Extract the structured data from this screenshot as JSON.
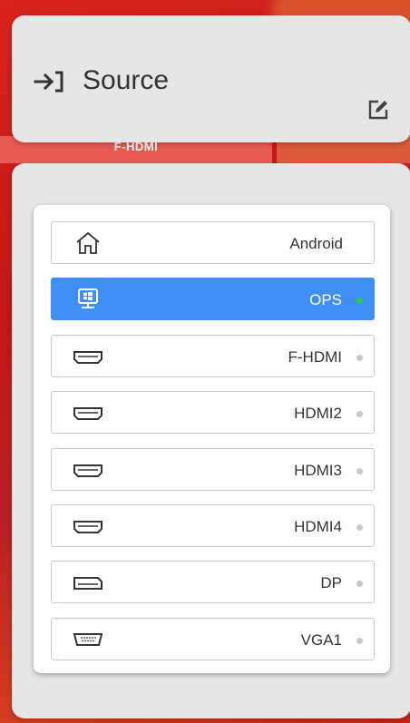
{
  "background": {
    "tile_label": "F-HDMI"
  },
  "header": {
    "icon": "input-arrow-icon",
    "title": "Source",
    "edit_icon": "edit-icon"
  },
  "colors": {
    "active_bg": "#3f8ef5",
    "signal_dot": "#2ecc40",
    "idle_dot": "#c8c8c8",
    "card_bg": "#e6e6e6"
  },
  "sources": [
    {
      "label": "Android",
      "icon": "home-icon",
      "active": false,
      "status": "none"
    },
    {
      "label": "OPS",
      "icon": "windows-pc-icon",
      "active": true,
      "status": "signal"
    },
    {
      "label": "F-HDMI",
      "icon": "hdmi-port-icon",
      "active": false,
      "status": "idle"
    },
    {
      "label": "HDMI2",
      "icon": "hdmi-port-icon",
      "active": false,
      "status": "idle"
    },
    {
      "label": "HDMI3",
      "icon": "hdmi-port-icon",
      "active": false,
      "status": "idle"
    },
    {
      "label": "HDMI4",
      "icon": "hdmi-port-icon",
      "active": false,
      "status": "idle"
    },
    {
      "label": "DP",
      "icon": "displayport-icon",
      "active": false,
      "status": "idle"
    },
    {
      "label": "VGA1",
      "icon": "vga-port-icon",
      "active": false,
      "status": "idle"
    }
  ]
}
